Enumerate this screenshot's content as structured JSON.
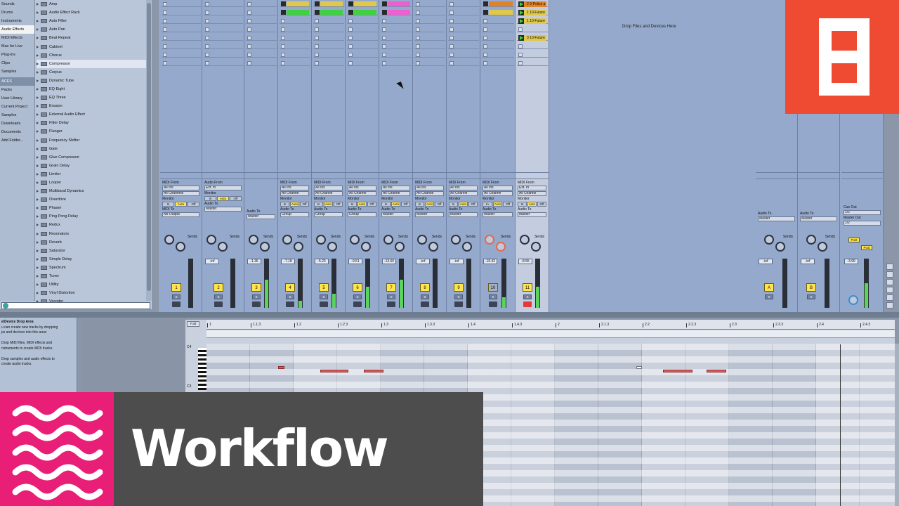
{
  "browser": {
    "categories": [
      {
        "label": "Sounds",
        "selected": false
      },
      {
        "label": "Drums",
        "selected": false
      },
      {
        "label": "Instruments",
        "selected": false
      },
      {
        "label": "Audio Effects",
        "selected": true
      },
      {
        "label": "MIDI Effects",
        "selected": false
      },
      {
        "label": "Max for Live",
        "selected": false
      },
      {
        "label": "Plug-ins",
        "selected": false
      },
      {
        "label": "Clips",
        "selected": false
      },
      {
        "label": "Samples",
        "selected": false
      }
    ],
    "places_header": "ACES",
    "places": [
      "Packs",
      "User Library",
      "Current Project",
      "Samples",
      "Downloads",
      "Documents",
      "Add Folder..."
    ],
    "items": [
      "Amp",
      "Audio Effect Rack",
      "Auto Filter",
      "Auto Pan",
      "Beat Repeat",
      "Cabinet",
      "Chorus",
      "Compressor",
      "Corpus",
      "Dynamic Tube",
      "EQ Eight",
      "EQ Three",
      "Erosion",
      "External Audio Effect",
      "Filter Delay",
      "Flanger",
      "Frequency Shifter",
      "Gate",
      "Glue Compressor",
      "Grain Delay",
      "Limiter",
      "Looper",
      "Multiband Dynamics",
      "Overdrive",
      "Phaser",
      "Ping Pong Delay",
      "Redux",
      "Resonators",
      "Reverb",
      "Saturator",
      "Simple Delay",
      "Spectrum",
      "Tuner",
      "Utility",
      "Vinyl Distortion",
      "Vocoder"
    ],
    "selected_item": "Compressor"
  },
  "session": {
    "drop_text": "Drop Files and Devices Here",
    "clips": [
      "2 9-Police a",
      "1 10-Future",
      "1 10-Future",
      "3 10-Future",
      "3 10-Future"
    ],
    "tracks": [
      {
        "num": "1",
        "vol": "",
        "io_from": "MIDI From",
        "io_in": "All Ins",
        "io_ch": "All Channels",
        "out_label": "MIDI To",
        "out": "No Output"
      },
      {
        "num": "2",
        "vol": "-inf",
        "io_from": "Audio From",
        "io_in": "Ext. In",
        "io_ch": "",
        "out_label": "Audio To",
        "out": "Master"
      },
      {
        "num": "3",
        "vol": "-1.36",
        "io_from": "",
        "io_in": "",
        "io_ch": "",
        "out_label": "Audio To",
        "out": "Master"
      },
      {
        "num": "4",
        "vol": "-7.18",
        "io_from": "MIDI From",
        "io_in": "All Ins",
        "io_ch": "All Channe",
        "out_label": "Audio To",
        "out": "Group"
      },
      {
        "num": "5",
        "vol": "-5.23",
        "io_from": "MIDI From",
        "io_in": "All Ins",
        "io_ch": "All Channe",
        "out_label": "Audio To",
        "out": "Group"
      },
      {
        "num": "6",
        "vol": "-9.51",
        "io_from": "MIDI From",
        "io_in": "All Ins",
        "io_ch": "All Channe",
        "out_label": "Audio To",
        "out": "Group"
      },
      {
        "num": "7",
        "vol": "-13.60",
        "io_from": "MIDI From",
        "io_in": "All Ins",
        "io_ch": "All Channe",
        "out_label": "Audio To",
        "out": "Master"
      },
      {
        "num": "8",
        "vol": "-inf",
        "io_from": "MIDI From",
        "io_in": "All Ins",
        "io_ch": "All Channe",
        "out_label": "Audio To",
        "out": "Master"
      },
      {
        "num": "9",
        "vol": "-inf",
        "io_from": "MIDI From",
        "io_in": "All Ins",
        "io_ch": "All Channe",
        "out_label": "Audio To",
        "out": "Master"
      },
      {
        "num": "10",
        "vol": "-15.42",
        "io_from": "MIDI From",
        "io_in": "All Ins",
        "io_ch": "All Channe",
        "out_label": "Audio To",
        "out": "Master"
      },
      {
        "num": "11",
        "vol": "-8.55",
        "io_from": "MIDI From",
        "io_in": "Ext. In",
        "io_ch": "All Channe",
        "out_label": "Audio To",
        "out": "Master"
      }
    ],
    "returns": [
      {
        "num": "A",
        "vol": "-inf",
        "out_label": "Audio To",
        "out": "Master"
      },
      {
        "num": "B",
        "vol": "-inf",
        "out_label": "Audio To",
        "out": "Master"
      }
    ],
    "master": {
      "vol": "-3.99",
      "cue_label": "Cue Out",
      "cue": "1/2",
      "out_label": "Master Out",
      "out": "1/2",
      "post": "Post"
    },
    "monitor": {
      "label": "Monitor",
      "in": "In",
      "auto": "Auto",
      "off": "Off"
    },
    "sends_label": "Sends",
    "solo": "S",
    "scale": [
      "6",
      "0",
      "6",
      "12",
      "24",
      "36",
      "60"
    ]
  },
  "info": {
    "title": "e/Device Drop Area",
    "lines": [
      "u can create new tracks by dropping",
      "ps and devices into this area:",
      "",
      "Drop MIDI files, MIDI effects and",
      "nstruments to create MIDI tracks.",
      "",
      "Drop samples and audio effects to",
      "create audio tracks."
    ]
  },
  "editor": {
    "fold": "Fold",
    "ruler": [
      "1",
      "1.1.3",
      "1.2",
      "1.2.3",
      "1.3",
      "1.3.3",
      "1.4",
      "1.4.3",
      "2",
      "2.1.3",
      "2.2",
      "2.2.3",
      "2.3",
      "2.3.3",
      "2.4",
      "2.4.3"
    ],
    "key_labels": [
      "C4",
      "C3"
    ]
  },
  "lower_third": {
    "title": "Workflow"
  },
  "colors": {
    "accent_orange": "#ef4b32",
    "accent_pink": "#e91e77",
    "clip_green": "#3fd13f",
    "clip_pink": "#ec5fd0",
    "clip_orange": "#e0822a",
    "clip_yellow": "#e0c84a"
  }
}
